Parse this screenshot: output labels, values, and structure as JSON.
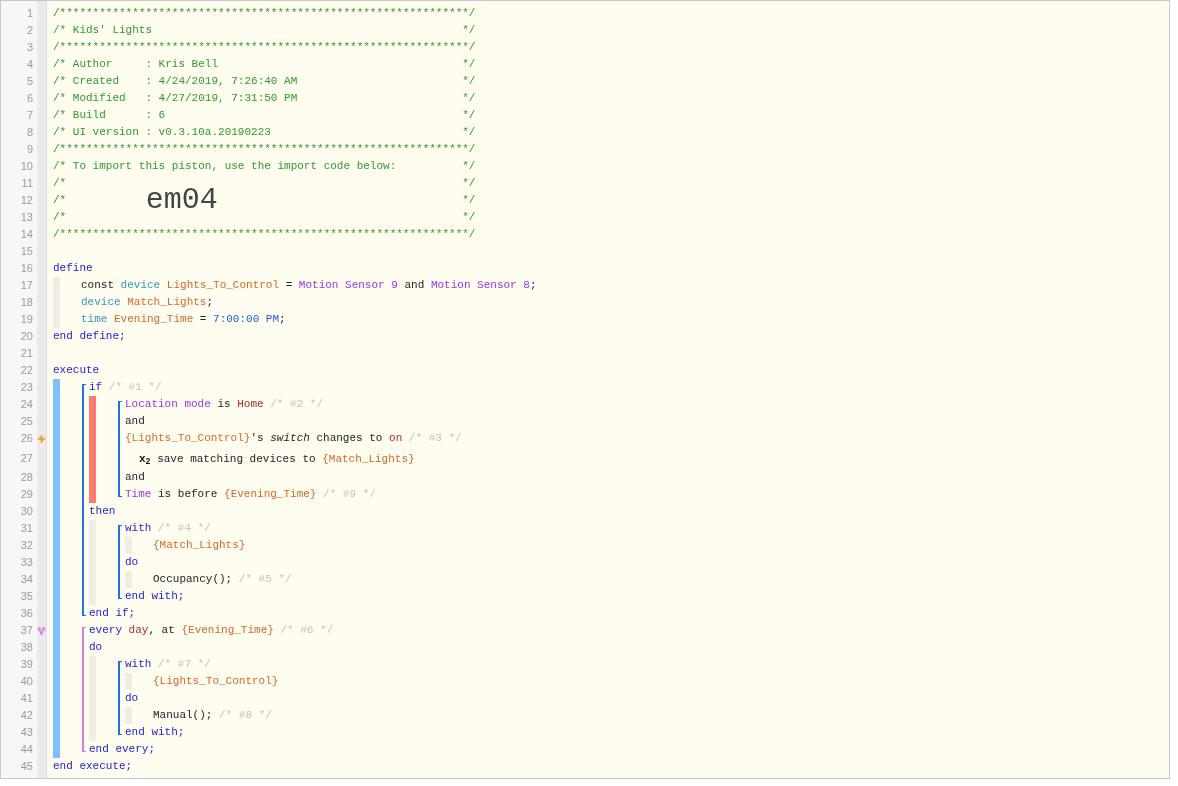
{
  "editor": {
    "lines": [
      {
        "kind": "banner",
        "number": "1",
        "segments": [
          {
            "text": "/**************************************************************/",
            "kind": "comment"
          }
        ]
      },
      {
        "kind": "banner",
        "number": "2",
        "segments": [
          {
            "text": "/* Kids' Lights",
            "kind": "comment"
          },
          {
            "text": "*/",
            "kind": "comment"
          }
        ]
      },
      {
        "kind": "banner",
        "number": "3",
        "segments": [
          {
            "text": "/**************************************************************/",
            "kind": "comment"
          }
        ]
      },
      {
        "kind": "banner",
        "number": "4",
        "segments": [
          {
            "text": "/* Author     : Kris Bell",
            "kind": "comment"
          },
          {
            "text": "*/",
            "kind": "comment"
          }
        ]
      },
      {
        "kind": "banner",
        "number": "5",
        "segments": [
          {
            "text": "/* Created    : 4/24/2019, 7:26:40 AM",
            "kind": "comment"
          },
          {
            "text": "*/",
            "kind": "comment"
          }
        ]
      },
      {
        "kind": "banner",
        "number": "6",
        "segments": [
          {
            "text": "/* Modified   : 4/27/2019, 7:31:50 PM",
            "kind": "comment"
          },
          {
            "text": "*/",
            "kind": "comment"
          }
        ]
      },
      {
        "kind": "banner",
        "number": "7",
        "segments": [
          {
            "text": "/* Build      : 6",
            "kind": "comment"
          },
          {
            "text": "*/",
            "kind": "comment"
          }
        ]
      },
      {
        "kind": "banner",
        "number": "8",
        "segments": [
          {
            "text": "/* UI version : v0.3.10a.20190223",
            "kind": "comment"
          },
          {
            "text": "*/",
            "kind": "comment"
          }
        ]
      },
      {
        "kind": "banner",
        "number": "9",
        "segments": [
          {
            "text": "/**************************************************************/",
            "kind": "comment"
          }
        ]
      },
      {
        "kind": "banner",
        "number": "10",
        "segments": [
          {
            "text": "/* To import this piston, use the import code below:",
            "kind": "comment"
          },
          {
            "text": "*/",
            "kind": "comment"
          }
        ]
      },
      {
        "kind": "banner",
        "number": "11",
        "segments": [
          {
            "text": "/*",
            "kind": "comment"
          },
          {
            "text": "*/",
            "kind": "comment"
          }
        ]
      },
      {
        "kind": "banner",
        "number": "12",
        "segments": [
          {
            "text": "/*",
            "kind": "comment"
          },
          {
            "text": "em04",
            "kind": "big"
          },
          {
            "text": "*/",
            "kind": "comment"
          }
        ]
      },
      {
        "kind": "banner",
        "number": "13",
        "segments": [
          {
            "text": "/*",
            "kind": "comment"
          },
          {
            "text": "*/",
            "kind": "comment"
          }
        ]
      },
      {
        "kind": "banner",
        "number": "14",
        "segments": [
          {
            "text": "/**************************************************************/",
            "kind": "comment"
          }
        ]
      },
      {
        "kind": "code",
        "number": "15"
      },
      {
        "kind": "code",
        "number": "16",
        "segments": [
          {
            "text": "define",
            "kind": "keyword"
          }
        ]
      },
      {
        "kind": "bar",
        "color": "#f0ede4",
        "items": [
          {
            "kind": "code",
            "number": "17",
            "segments": [
              {
                "text": "const ",
                "kind": "plain"
              },
              {
                "text": "device ",
                "kind": "type"
              },
              {
                "text": "Lights_To_Control",
                "kind": "variable"
              },
              {
                "text": " = ",
                "kind": "plain"
              },
              {
                "text": "Motion Sensor 9",
                "kind": "device"
              },
              {
                "text": " and ",
                "kind": "plain"
              },
              {
                "text": "Motion Sensor 8",
                "kind": "device"
              },
              {
                "text": ";",
                "kind": "plain"
              }
            ]
          },
          {
            "kind": "code",
            "number": "18",
            "segments": [
              {
                "text": "device ",
                "kind": "type"
              },
              {
                "text": "Match_Lights",
                "kind": "variable"
              },
              {
                "text": ";",
                "kind": "plain"
              }
            ]
          },
          {
            "kind": "code",
            "number": "19",
            "segments": [
              {
                "text": "time ",
                "kind": "type"
              },
              {
                "text": "Evening_Time",
                "kind": "variable"
              },
              {
                "text": " = ",
                "kind": "plain"
              },
              {
                "text": "7:00:00 PM",
                "kind": "value"
              },
              {
                "text": ";",
                "kind": "plain"
              }
            ]
          }
        ]
      },
      {
        "kind": "code",
        "number": "20",
        "segments": [
          {
            "text": "end define;",
            "kind": "keyword"
          }
        ]
      },
      {
        "kind": "code",
        "number": "21"
      },
      {
        "kind": "code",
        "number": "22",
        "segments": [
          {
            "text": "execute",
            "kind": "keyword"
          }
        ]
      },
      {
        "kind": "bar",
        "color": "#80bfff",
        "items": [
          {
            "kind": "bracket",
            "color": "#1f74d8",
            "items": [
              {
                "kind": "code",
                "number": "23",
                "segments": [
                  {
                    "text": "if",
                    "kind": "keyword"
                  },
                  {
                    "text": " /* #1 */",
                    "kind": "dim"
                  }
                ]
              },
              {
                "kind": "bar",
                "color": "#ff7b70",
                "items": [
                  {
                    "kind": "bracket",
                    "color": "#1f74d8",
                    "items": [
                      {
                        "kind": "code",
                        "number": "24",
                        "segments": [
                          {
                            "text": "Location mode",
                            "kind": "device"
                          },
                          {
                            "text": " is ",
                            "kind": "plain"
                          },
                          {
                            "text": "Home",
                            "kind": "literal"
                          },
                          {
                            "text": " /* #2 */",
                            "kind": "dim"
                          }
                        ]
                      },
                      {
                        "kind": "code",
                        "number": "25",
                        "segments": [
                          {
                            "text": "and",
                            "kind": "plain"
                          }
                        ]
                      },
                      {
                        "kind": "code",
                        "number": "26",
                        "trigger": true,
                        "segments": [
                          {
                            "text": "{Lights_To_Control}",
                            "kind": "variable"
                          },
                          {
                            "text": "'s ",
                            "kind": "plain"
                          },
                          {
                            "text": "switch",
                            "kind": "italic"
                          },
                          {
                            "text": " changes to ",
                            "kind": "plain"
                          },
                          {
                            "text": "on",
                            "kind": "literal"
                          },
                          {
                            "text": " /* #3 */",
                            "kind": "dim"
                          }
                        ]
                      },
                      {
                        "kind": "option",
                        "number": "27",
                        "segments": [
                          {
                            "text": "x$_{2}$",
                            "kind": "multiplier"
                          },
                          {
                            "text": " save matching devices to ",
                            "kind": "plain"
                          },
                          {
                            "text": "{Match_Lights}",
                            "kind": "variable"
                          }
                        ]
                      },
                      {
                        "kind": "code",
                        "number": "28",
                        "segments": [
                          {
                            "text": "and",
                            "kind": "plain"
                          }
                        ]
                      },
                      {
                        "kind": "code",
                        "number": "29",
                        "segments": [
                          {
                            "text": "Time",
                            "kind": "device"
                          },
                          {
                            "text": " is before ",
                            "kind": "plain"
                          },
                          {
                            "text": "{Evening_Time}",
                            "kind": "variable"
                          },
                          {
                            "text": " /* #9 */",
                            "kind": "dim"
                          }
                        ]
                      }
                    ]
                  }
                ]
              },
              {
                "kind": "code",
                "number": "30",
                "segments": [
                  {
                    "text": "then",
                    "kind": "keyword"
                  }
                ]
              },
              {
                "kind": "bar",
                "color": "#f0ede4",
                "items": [
                  {
                    "kind": "bracket",
                    "color": "#1f74d8",
                    "items": [
                      {
                        "kind": "code",
                        "number": "31",
                        "segments": [
                          {
                            "text": "with",
                            "kind": "keyword"
                          },
                          {
                            "text": " /* #4 */",
                            "kind": "dim"
                          }
                        ]
                      },
                      {
                        "kind": "bar",
                        "color": "#f0ede4",
                        "items": [
                          {
                            "kind": "code",
                            "number": "32",
                            "segments": [
                              {
                                "text": "{Match_Lights}",
                                "kind": "variable"
                              }
                            ]
                          }
                        ]
                      },
                      {
                        "kind": "code",
                        "number": "33",
                        "segments": [
                          {
                            "text": "do",
                            "kind": "keyword"
                          }
                        ]
                      },
                      {
                        "kind": "bar",
                        "color": "#f0ede4",
                        "items": [
                          {
                            "kind": "code",
                            "number": "34",
                            "segments": [
                              {
                                "text": "Occupancy();",
                                "kind": "plain"
                              },
                              {
                                "text": " /* #5 */",
                                "kind": "dim"
                              }
                            ]
                          }
                        ]
                      },
                      {
                        "kind": "code",
                        "number": "35",
                        "segments": [
                          {
                            "text": "end with;",
                            "kind": "keyword"
                          }
                        ]
                      }
                    ]
                  }
                ]
              },
              {
                "kind": "code",
                "number": "36",
                "segments": [
                  {
                    "text": "end if;",
                    "kind": "keyword"
                  }
                ]
              }
            ]
          },
          {
            "kind": "bracket",
            "color": "#d67fd6",
            "items": [
              {
                "kind": "code",
                "number": "37",
                "timer": true,
                "segments": [
                  {
                    "text": "every ",
                    "kind": "keyword"
                  },
                  {
                    "text": "day",
                    "kind": "literal"
                  },
                  {
                    "text": ", at ",
                    "kind": "plain"
                  },
                  {
                    "text": "{Evening_Time}",
                    "kind": "variable"
                  },
                  {
                    "text": " /* #6 */",
                    "kind": "dim"
                  }
                ]
              },
              {
                "kind": "code",
                "number": "38",
                "segments": [
                  {
                    "text": "do",
                    "kind": "keyword"
                  }
                ]
              },
              {
                "kind": "bar",
                "color": "#f0ede4",
                "items": [
                  {
                    "kind": "bracket",
                    "color": "#1f74d8",
                    "items": [
                      {
                        "kind": "code",
                        "number": "39",
                        "segments": [
                          {
                            "text": "with",
                            "kind": "keyword"
                          },
                          {
                            "text": " /* #7 */",
                            "kind": "dim"
                          }
                        ]
                      },
                      {
                        "kind": "bar",
                        "color": "#f0ede4",
                        "items": [
                          {
                            "kind": "code",
                            "number": "40",
                            "segments": [
                              {
                                "text": "{Lights_To_Control}",
                                "kind": "variable"
                              }
                            ]
                          }
                        ]
                      },
                      {
                        "kind": "code",
                        "number": "41",
                        "segments": [
                          {
                            "text": "do",
                            "kind": "keyword"
                          }
                        ]
                      },
                      {
                        "kind": "bar",
                        "color": "#f0ede4",
                        "items": [
                          {
                            "kind": "code",
                            "number": "42",
                            "segments": [
                              {
                                "text": "Manual();",
                                "kind": "plain"
                              },
                              {
                                "text": " /* #8 */",
                                "kind": "dim"
                              }
                            ]
                          }
                        ]
                      },
                      {
                        "kind": "code",
                        "number": "43",
                        "segments": [
                          {
                            "text": "end with;",
                            "kind": "keyword"
                          }
                        ]
                      }
                    ]
                  }
                ]
              },
              {
                "kind": "code",
                "number": "44",
                "segments": [
                  {
                    "text": "end every;",
                    "kind": "keyword"
                  }
                ]
              }
            ]
          }
        ]
      },
      {
        "kind": "code",
        "number": "45",
        "segments": [
          {
            "text": "end execute;",
            "kind": "keyword"
          }
        ]
      }
    ]
  }
}
